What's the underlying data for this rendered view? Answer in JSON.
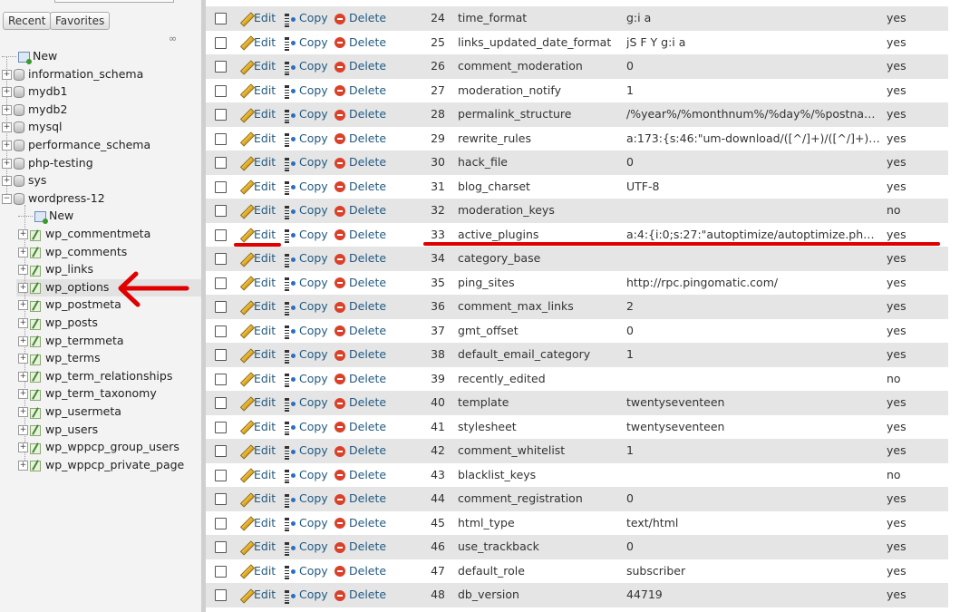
{
  "sidebar": {
    "tabs": {
      "recent": "Recent",
      "favorites": "Favorites"
    },
    "tree": [
      {
        "label": "New",
        "kind": "new",
        "level": 0
      },
      {
        "label": "information_schema",
        "kind": "db",
        "level": 0
      },
      {
        "label": "mydb1",
        "kind": "db",
        "level": 0
      },
      {
        "label": "mydb2",
        "kind": "db",
        "level": 0
      },
      {
        "label": "mysql",
        "kind": "db",
        "level": 0
      },
      {
        "label": "performance_schema",
        "kind": "db",
        "level": 0
      },
      {
        "label": "php-testing",
        "kind": "db",
        "level": 0
      },
      {
        "label": "sys",
        "kind": "db",
        "level": 0
      },
      {
        "label": "wordpress-12",
        "kind": "db-open",
        "level": 0
      },
      {
        "label": "New",
        "kind": "new",
        "level": 1
      },
      {
        "label": "wp_commentmeta",
        "kind": "table",
        "level": 1
      },
      {
        "label": "wp_comments",
        "kind": "table",
        "level": 1
      },
      {
        "label": "wp_links",
        "kind": "table",
        "level": 1
      },
      {
        "label": "wp_options",
        "kind": "table",
        "level": 1,
        "selected": true
      },
      {
        "label": "wp_postmeta",
        "kind": "table",
        "level": 1
      },
      {
        "label": "wp_posts",
        "kind": "table",
        "level": 1
      },
      {
        "label": "wp_termmeta",
        "kind": "table",
        "level": 1
      },
      {
        "label": "wp_terms",
        "kind": "table",
        "level": 1
      },
      {
        "label": "wp_term_relationships",
        "kind": "table",
        "level": 1
      },
      {
        "label": "wp_term_taxonomy",
        "kind": "table",
        "level": 1
      },
      {
        "label": "wp_usermeta",
        "kind": "table",
        "level": 1
      },
      {
        "label": "wp_users",
        "kind": "table",
        "level": 1
      },
      {
        "label": "wp_wppcp_group_users",
        "kind": "table",
        "level": 1
      },
      {
        "label": "wp_wppcp_private_page",
        "kind": "table",
        "level": 1
      }
    ]
  },
  "actions": {
    "edit": "Edit",
    "copy": "Copy",
    "delete": "Delete"
  },
  "rows": [
    {
      "id": "24",
      "name": "time_format",
      "value": "g:i a",
      "autoload": "yes"
    },
    {
      "id": "25",
      "name": "links_updated_date_format",
      "value": "jS F Y g:i a",
      "autoload": "yes"
    },
    {
      "id": "26",
      "name": "comment_moderation",
      "value": "0",
      "autoload": "yes"
    },
    {
      "id": "27",
      "name": "moderation_notify",
      "value": "1",
      "autoload": "yes"
    },
    {
      "id": "28",
      "name": "permalink_structure",
      "value": "/%year%/%monthnum%/%day%/%postname%/",
      "autoload": "yes"
    },
    {
      "id": "29",
      "name": "rewrite_rules",
      "value": "a:173:{s:46:\"um-download/([^/]+)/([^/]+)/([^/]+)/(...",
      "autoload": "yes"
    },
    {
      "id": "30",
      "name": "hack_file",
      "value": "0",
      "autoload": "yes"
    },
    {
      "id": "31",
      "name": "blog_charset",
      "value": "UTF-8",
      "autoload": "yes"
    },
    {
      "id": "32",
      "name": "moderation_keys",
      "value": "",
      "autoload": "no"
    },
    {
      "id": "33",
      "name": "active_plugins",
      "value": "a:4:{i:0;s:27:\"autoptimize/autoptimize.php\";i:1;s:...",
      "autoload": "yes"
    },
    {
      "id": "34",
      "name": "category_base",
      "value": "",
      "autoload": "yes"
    },
    {
      "id": "35",
      "name": "ping_sites",
      "value": "http://rpc.pingomatic.com/",
      "autoload": "yes"
    },
    {
      "id": "36",
      "name": "comment_max_links",
      "value": "2",
      "autoload": "yes"
    },
    {
      "id": "37",
      "name": "gmt_offset",
      "value": "0",
      "autoload": "yes"
    },
    {
      "id": "38",
      "name": "default_email_category",
      "value": "1",
      "autoload": "yes"
    },
    {
      "id": "39",
      "name": "recently_edited",
      "value": "",
      "autoload": "no"
    },
    {
      "id": "40",
      "name": "template",
      "value": "twentyseventeen",
      "autoload": "yes"
    },
    {
      "id": "41",
      "name": "stylesheet",
      "value": "twentyseventeen",
      "autoload": "yes"
    },
    {
      "id": "42",
      "name": "comment_whitelist",
      "value": "1",
      "autoload": "yes"
    },
    {
      "id": "43",
      "name": "blacklist_keys",
      "value": "",
      "autoload": "no"
    },
    {
      "id": "44",
      "name": "comment_registration",
      "value": "0",
      "autoload": "yes"
    },
    {
      "id": "45",
      "name": "html_type",
      "value": "text/html",
      "autoload": "yes"
    },
    {
      "id": "46",
      "name": "use_trackback",
      "value": "0",
      "autoload": "yes"
    },
    {
      "id": "47",
      "name": "default_role",
      "value": "subscriber",
      "autoload": "yes"
    },
    {
      "id": "48",
      "name": "db_version",
      "value": "44719",
      "autoload": "yes"
    }
  ],
  "colors": {
    "link": "#235a81",
    "row_alt": "#e5e5e5",
    "annotation": "#e00000"
  }
}
